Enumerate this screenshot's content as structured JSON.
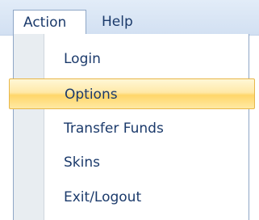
{
  "menubar": {
    "menus": [
      {
        "label": "Action",
        "state": "open"
      },
      {
        "label": "Help"
      }
    ]
  },
  "dropdown": {
    "items": [
      {
        "label": "Login"
      },
      {
        "label": "Options",
        "state": "highlighted"
      },
      {
        "label": "Transfer Funds"
      },
      {
        "label": "Skins"
      },
      {
        "label": "Exit/Logout"
      }
    ]
  },
  "colors": {
    "menubar_bg": "#d8e4f4",
    "menu_text": "#1b3a6b",
    "highlight_fill": "#ffd66a",
    "highlight_border": "#e8b74a",
    "gutter": "#e8edf1"
  }
}
